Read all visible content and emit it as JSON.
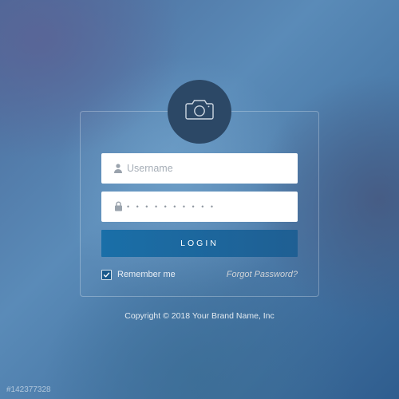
{
  "avatar_icon": "camera-icon",
  "fields": {
    "username": {
      "placeholder": "Username",
      "value": ""
    },
    "password": {
      "placeholder": "",
      "masked": "• • • • • • • • • •"
    }
  },
  "login_label": "LOGIN",
  "remember": {
    "label": "Remember me",
    "checked": true
  },
  "forgot_label": "Forgot Password?",
  "copyright": "Copyright © 2018 Your Brand Name, Inc",
  "watermark": "#142377328",
  "colors": {
    "avatar_bg": "#2c4866",
    "button_bg": "#1a6fa8",
    "panel_border": "rgba(255,255,255,0.28)"
  }
}
